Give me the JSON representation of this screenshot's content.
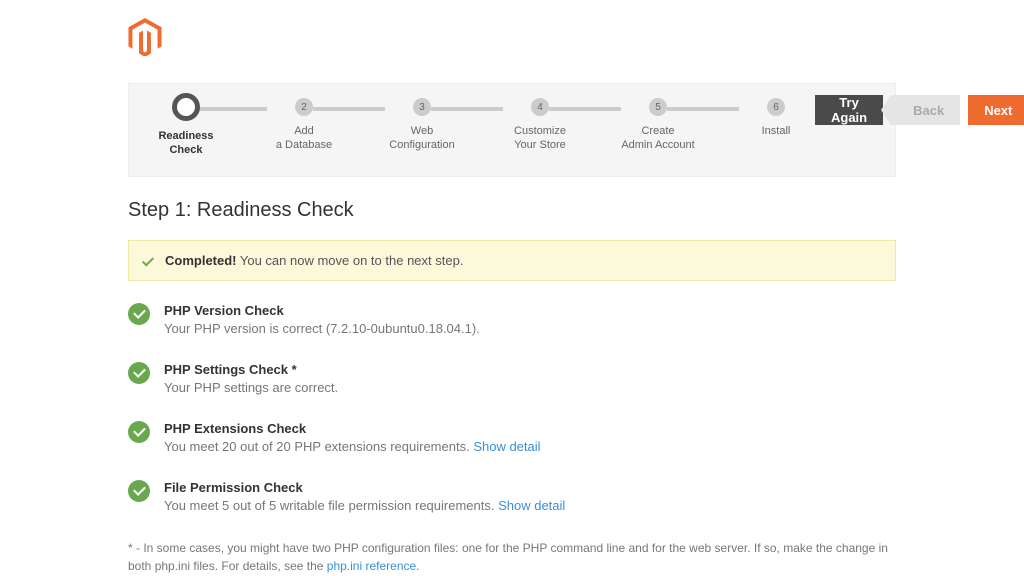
{
  "steps": [
    {
      "num": "",
      "label": "Readiness\nCheck",
      "active": true
    },
    {
      "num": "2",
      "label": "Add\na Database"
    },
    {
      "num": "3",
      "label": "Web\nConfiguration"
    },
    {
      "num": "4",
      "label": "Customize\nYour Store"
    },
    {
      "num": "5",
      "label": "Create\nAdmin Account"
    },
    {
      "num": "6",
      "label": "Install"
    }
  ],
  "actions": {
    "try_again": "Try Again",
    "back": "Back",
    "next": "Next"
  },
  "page_title": "Step 1: Readiness Check",
  "alert": {
    "strong": "Completed!",
    "text": " You can now move on to the next step."
  },
  "checks": [
    {
      "title": "PHP Version Check",
      "desc": "Your PHP version is correct (7.2.10-0ubuntu0.18.04.1).",
      "link": ""
    },
    {
      "title": "PHP Settings Check *",
      "desc": "Your PHP settings are correct.",
      "link": ""
    },
    {
      "title": "PHP Extensions Check",
      "desc": "You meet 20 out of 20 PHP extensions requirements. ",
      "link": "Show detail"
    },
    {
      "title": "File Permission Check",
      "desc": "You meet 5 out of 5 writable file permission requirements. ",
      "link": "Show detail"
    }
  ],
  "footnote": {
    "text": "* - In some cases, you might have two PHP configuration files: one for the PHP command line and for the web server. If so, make the change in both php.ini files. For details, see the ",
    "link": "php.ini reference",
    "after": "."
  }
}
